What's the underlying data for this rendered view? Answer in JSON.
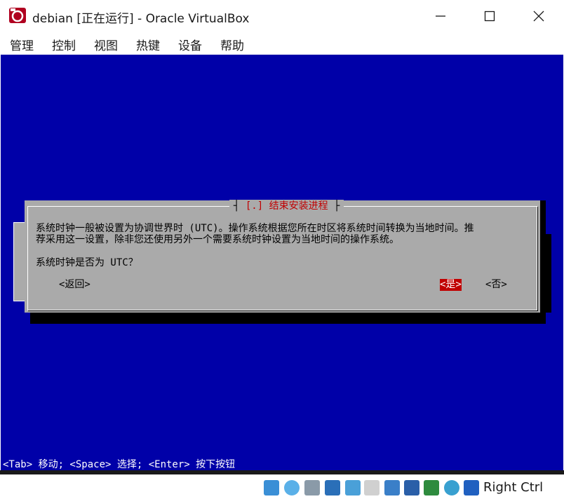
{
  "window": {
    "title": "debian [正在运行] - Oracle VirtualBox"
  },
  "menu": {
    "items": [
      "管理",
      "控制",
      "视图",
      "热键",
      "设备",
      "帮助"
    ]
  },
  "dialog": {
    "title": "[.] 结束安装进程",
    "description_line1": "系统时钟一般被设置为协调世界时 (UTC)。操作系统根据您所在时区将系统时间转换为当地时间。推",
    "description_line2": "荐采用这一设置，除非您还使用另外一个需要系统时钟设置为当地时间的操作系统。",
    "question": "系统时钟是否为 UTC？",
    "back_button": "<返回>",
    "yes_button": "<是>",
    "no_button": "<否>"
  },
  "vm_status_line": "<Tab> 移动; <Space> 选择; <Enter> 按下按钮",
  "statusbar": {
    "host_key": "Right Ctrl",
    "icons": [
      "hard-disk-icon",
      "optical-drive-icon",
      "audio-icon",
      "network-icon",
      "usb-icon",
      "shared-folders-icon",
      "display-icon",
      "video-capture-icon",
      "mouse-integration-icon",
      "guest-additions-icon",
      "download-icon"
    ]
  },
  "colors": {
    "vm_background": "#0000a8",
    "dialog_background": "#aaaaaa",
    "accent_red": "#c00000"
  }
}
